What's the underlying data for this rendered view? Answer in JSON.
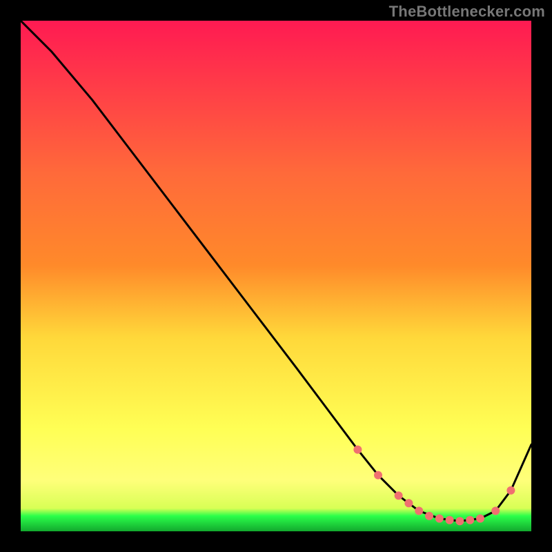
{
  "attribution": "TheBottlenecker.com",
  "chart_data": {
    "type": "line",
    "title": "",
    "xlabel": "",
    "ylabel": "",
    "xlim": [
      0,
      100
    ],
    "ylim": [
      0,
      100
    ],
    "grid": false,
    "legend": false,
    "colors": {
      "gradient_top": "#ff1a52",
      "gradient_mid_upper": "#ff8a2a",
      "gradient_mid": "#ffd83a",
      "gradient_lower": "#ffff7a",
      "gradient_green": "#2bff4a",
      "gradient_bottom": "#12a82e",
      "line": "#000000",
      "marker": "#f07070"
    },
    "series": [
      {
        "name": "curve",
        "x": [
          0,
          6,
          14,
          22,
          30,
          38,
          46,
          54,
          60,
          66,
          70,
          74,
          78,
          82,
          86,
          90,
          93,
          96,
          100
        ],
        "y": [
          100,
          94,
          84.5,
          74,
          63.5,
          53,
          42.5,
          32,
          24,
          16,
          11,
          7,
          4,
          2.5,
          2,
          2.5,
          4,
          8,
          17
        ]
      }
    ],
    "markers": {
      "x": [
        66,
        70,
        74,
        76,
        78,
        80,
        82,
        84,
        86,
        88,
        90,
        93,
        96
      ],
      "y": [
        16,
        11,
        7,
        5.5,
        4,
        3,
        2.5,
        2.2,
        2,
        2.2,
        2.5,
        4,
        8
      ]
    }
  }
}
